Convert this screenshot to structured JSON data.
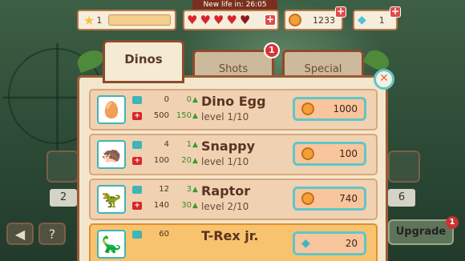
{
  "hud": {
    "level": "1",
    "new_life_label": "New life in: 26:05",
    "coins": "1233",
    "gems": "1",
    "plus": "+",
    "hearts_full": 4,
    "hearts_total": 5,
    "star_icon": "★",
    "heart_icon": "♥",
    "gem_icon": "◆"
  },
  "tabs": [
    {
      "label": "Dinos"
    },
    {
      "label": "Shots",
      "badge": "1"
    },
    {
      "label": "Special"
    }
  ],
  "close_icon": "✕",
  "dinos": [
    {
      "name": "Dino Egg",
      "level": "level 1/10",
      "attack": "0",
      "attack_up": "0",
      "health": "500",
      "health_up": "150",
      "price": "1000",
      "currency": "coin",
      "portrait": "egg"
    },
    {
      "name": "Snappy",
      "level": "level 1/10",
      "attack": "4",
      "attack_up": "1",
      "health": "100",
      "health_up": "20",
      "price": "100",
      "currency": "coin",
      "portrait": "snappy"
    },
    {
      "name": "Raptor",
      "level": "level 2/10",
      "attack": "12",
      "attack_up": "3",
      "health": "140",
      "health_up": "30",
      "price": "740",
      "currency": "coin",
      "portrait": "raptor"
    },
    {
      "name": "T-Rex jr.",
      "level": "",
      "attack": "60",
      "attack_up": "",
      "health": "",
      "health_up": "",
      "price": "20",
      "currency": "gem",
      "portrait": "trex"
    }
  ],
  "side": {
    "left_count": "2",
    "right_count": "6",
    "back_icon": "◀",
    "help_icon": "?"
  },
  "upgrade": {
    "label": "Upgrade",
    "badge": "1"
  }
}
